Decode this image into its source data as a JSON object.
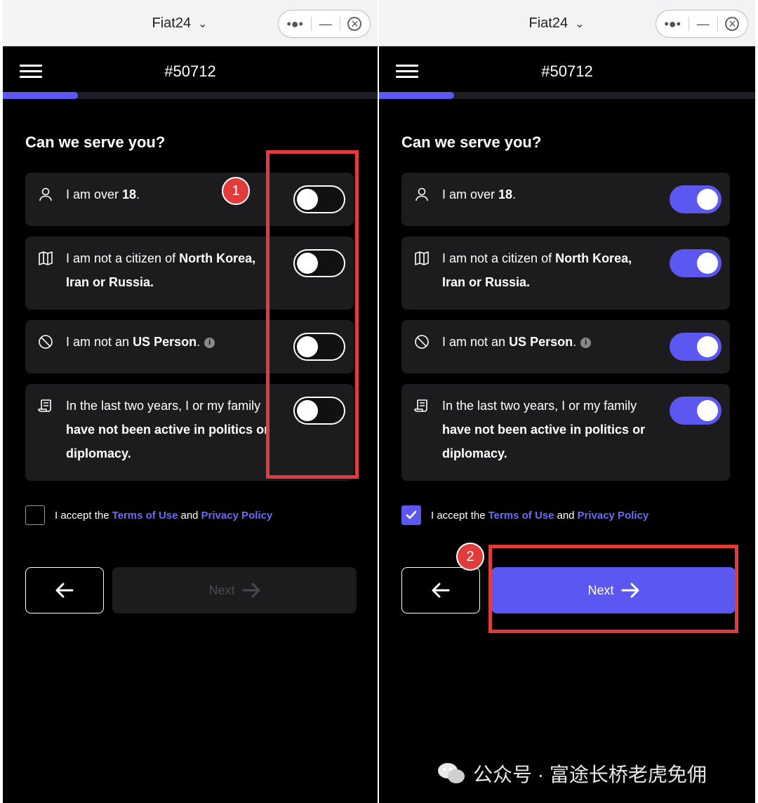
{
  "window": {
    "app_title": "Fiat24",
    "account_id": "#50712",
    "progress_fraction": 0.2
  },
  "form": {
    "heading": "Can we serve you?",
    "items": [
      {
        "icon": "user-icon",
        "parts": [
          {
            "t": "I am over ",
            "b": false
          },
          {
            "t": "18",
            "b": true
          },
          {
            "t": ".",
            "b": false
          }
        ]
      },
      {
        "icon": "map-icon",
        "parts": [
          {
            "t": "I am not a citizen of ",
            "b": false
          },
          {
            "t": "North Korea, Iran or Russia.",
            "b": true
          }
        ]
      },
      {
        "icon": "prohibited-icon",
        "parts": [
          {
            "t": "I am not an ",
            "b": false
          },
          {
            "t": "US Person",
            "b": true
          },
          {
            "t": ".",
            "b": false
          }
        ],
        "info": "i"
      },
      {
        "icon": "document-icon",
        "parts": [
          {
            "t": "In the last two years, I or my family ",
            "b": false
          },
          {
            "t": "have not been active in politics or diplomacy.",
            "b": true
          }
        ]
      }
    ],
    "terms": {
      "prefix": "I accept the",
      "terms_link": "Terms of Use",
      "joiner": "and",
      "privacy_link": "Privacy Policy"
    },
    "next_label": "Next"
  },
  "panels": [
    {
      "toggles": [
        false,
        false,
        false,
        false
      ],
      "terms_checked": false,
      "next_enabled": false
    },
    {
      "toggles": [
        true,
        true,
        true,
        true
      ],
      "terms_checked": true,
      "next_enabled": true
    }
  ],
  "annotations": {
    "badge_1": "1",
    "badge_2": "2"
  },
  "watermark": "公众号 · 富途长桥老虎免佣",
  "colors": {
    "accent": "#5b57f0",
    "annotation_red": "#e23b3b",
    "card_bg": "#1c1c1f"
  }
}
